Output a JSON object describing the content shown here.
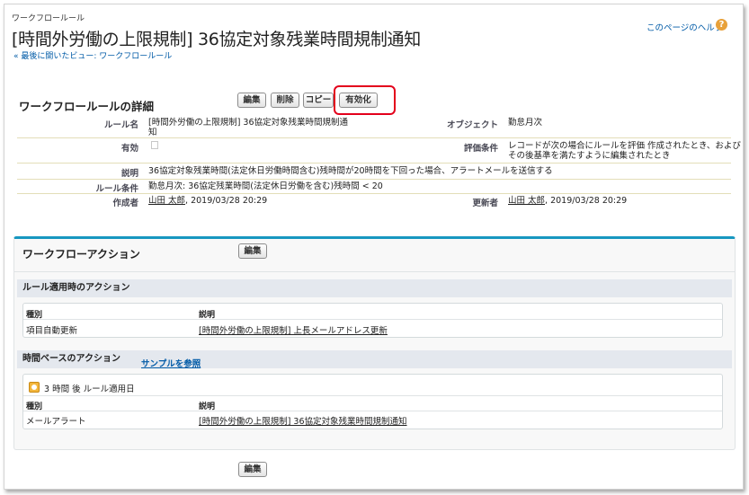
{
  "header": {
    "object_label": "ワークフロールール",
    "title": "[時間外労働の上限規制] 36協定対象残業時間規制通知",
    "back_link": "« 最後に開いたビュー: ワークフロールール",
    "help_link": "このページのヘルプ",
    "help_icon": "help-icon"
  },
  "detail": {
    "section_title": "ワークフロールールの詳細",
    "buttons": {
      "edit": "編集",
      "delete": "削除",
      "copy": "コピー",
      "activate": "有効化"
    },
    "fields": {
      "rule_name_label": "ルール名",
      "rule_name_line1": "[時間外労働の上限規制] 36協定対象残業時間規制通",
      "rule_name_line2": "知",
      "object_label": "オブジェクト",
      "object_value": "勤怠月次",
      "active_label": "有効",
      "active_value": false,
      "eval_label": "評価条件",
      "eval_line1": "レコードが次の場合にルールを評価 作成されたとき、および",
      "eval_line2": "その後基準を満たすように編集されたとき",
      "desc_label": "説明",
      "desc_value": "36協定対象残業時間(法定休日労働時間含む)残時間が20時間を下回った場合、アラートメールを送信する",
      "criteria_label": "ルール条件",
      "criteria_value": "勤怠月次: 36協定残業時間(法定休日労働を含む)残時間 < 20",
      "created_label": "作成者",
      "created_user": "山田 太郎",
      "created_date": ", 2019/03/28 20:29",
      "modified_label": "更新者",
      "modified_user": "山田 太郎",
      "modified_date": ", 2019/03/28 20:29"
    }
  },
  "actions": {
    "section_title": "ワークフローアクション",
    "edit_button": "編集",
    "immediate": {
      "title": "ルール適用時のアクション",
      "columns": [
        "種別",
        "説明"
      ],
      "rows": [
        {
          "type": "項目自動更新",
          "description": "[時間外労働の上限規制] 上長メールアドレス更新"
        }
      ]
    },
    "time_based": {
      "title": "時間ベースのアクション",
      "sample_link": "サンプルを参照",
      "trigger": "3 時間 後 ルール適用日",
      "columns": [
        "種別",
        "説明"
      ],
      "rows": [
        {
          "type": "メールアラート",
          "description": "[時間外労働の上限規制] 36協定対象残業時間規制通知"
        }
      ]
    },
    "bottom_edit_button": "編集"
  }
}
